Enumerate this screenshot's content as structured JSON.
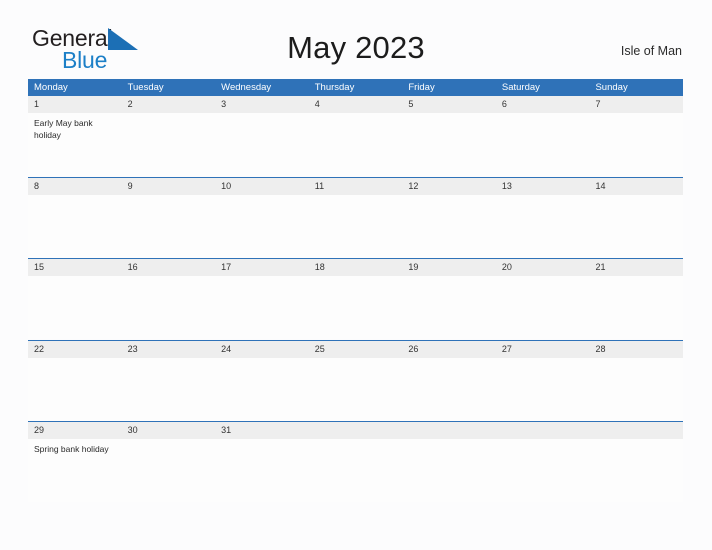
{
  "brand": {
    "word1": "General",
    "word2": "Blue",
    "flag_icon": "blue-triangle-flag-icon",
    "word1_color": "#231f20",
    "word2_color": "#1c7fc7",
    "flag_color": "#1c6fb5"
  },
  "header": {
    "title": "May 2023",
    "location": "Isle of Man"
  },
  "theme": {
    "header_blue": "#2f72b8",
    "date_band_gray": "#eeeeee",
    "page_background": "#fcfcfd"
  },
  "calendar": {
    "weekdays": [
      "Monday",
      "Tuesday",
      "Wednesday",
      "Thursday",
      "Friday",
      "Saturday",
      "Sunday"
    ],
    "weeks": [
      {
        "dates": [
          "1",
          "2",
          "3",
          "4",
          "5",
          "6",
          "7"
        ],
        "events": [
          "Early May bank holiday",
          "",
          "",
          "",
          "",
          "",
          ""
        ]
      },
      {
        "dates": [
          "8",
          "9",
          "10",
          "11",
          "12",
          "13",
          "14"
        ],
        "events": [
          "",
          "",
          "",
          "",
          "",
          "",
          ""
        ]
      },
      {
        "dates": [
          "15",
          "16",
          "17",
          "18",
          "19",
          "20",
          "21"
        ],
        "events": [
          "",
          "",
          "",
          "",
          "",
          "",
          ""
        ]
      },
      {
        "dates": [
          "22",
          "23",
          "24",
          "25",
          "26",
          "27",
          "28"
        ],
        "events": [
          "",
          "",
          "",
          "",
          "",
          "",
          ""
        ]
      },
      {
        "dates": [
          "29",
          "30",
          "31",
          "",
          "",
          "",
          ""
        ],
        "events": [
          "Spring bank holiday",
          "",
          "",
          "",
          "",
          "",
          ""
        ]
      }
    ]
  }
}
